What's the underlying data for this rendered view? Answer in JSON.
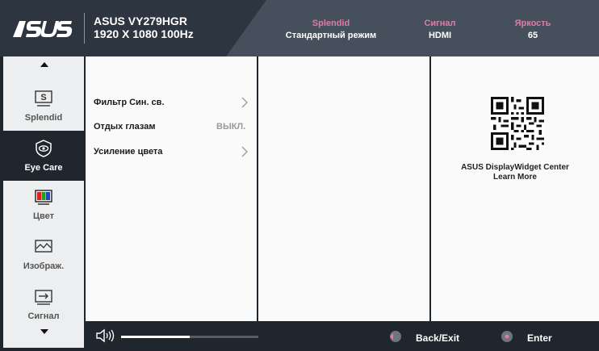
{
  "header": {
    "model_name": "ASUS VY279HGR",
    "resolution": "1920 X 1080 100Hz",
    "splendid_key": "Splendid",
    "splendid_value": "Стандартный режим",
    "signal_key": "Сигнал",
    "signal_value": "HDMI",
    "brightness_key": "Яркость",
    "brightness_value": "65"
  },
  "sidebar": {
    "items": [
      {
        "label": "Splendid",
        "icon": "splendid-icon"
      },
      {
        "label": "Eye Care",
        "icon": "eye-icon"
      },
      {
        "label": "Цвет",
        "icon": "color-icon"
      },
      {
        "label": "Изображ.",
        "icon": "image-icon"
      },
      {
        "label": "Сигнал",
        "icon": "input-icon"
      }
    ]
  },
  "menu": {
    "items": [
      {
        "label": "Фильтр Син. св.",
        "value": ""
      },
      {
        "label": "Отдых глазам",
        "value": "ВЫКЛ."
      },
      {
        "label": "Усиление цвета",
        "value": ""
      }
    ]
  },
  "promo": {
    "line1": "ASUS DisplayWidget Center",
    "line2": "Learn More"
  },
  "footer": {
    "volume_fraction": 0.5,
    "back_label": "Back/Exit",
    "enter_label": "Enter"
  },
  "colors": {
    "accent": "#e07ba9",
    "active_bg": "#1f262e",
    "header_bg": "#46505c"
  }
}
